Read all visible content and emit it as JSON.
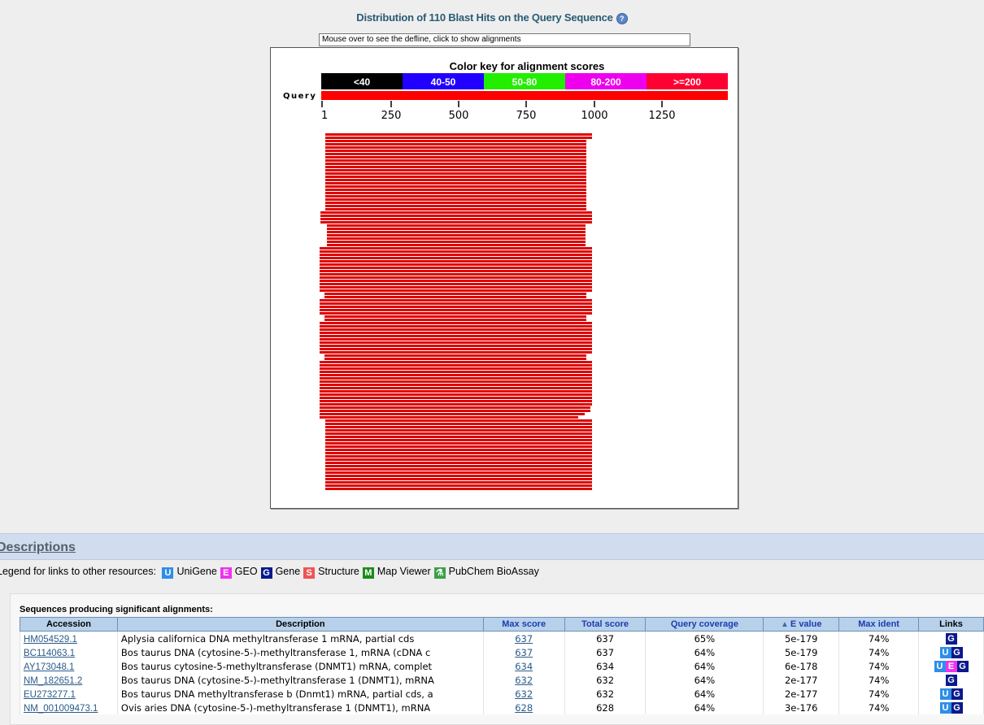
{
  "title": "Distribution of 110 Blast Hits on the Query Sequence",
  "help_icon": "?",
  "defline_text": "Mouse over to see the defline, click to show alignments",
  "graph": {
    "color_key_title": "Color key for alignment scores",
    "color_key": [
      {
        "label": "<40",
        "color": "#000000"
      },
      {
        "label": "40-50",
        "color": "#2200ff"
      },
      {
        "label": "50-80",
        "color": "#22ee00"
      },
      {
        "label": "80-200",
        "color": "#ee00ee"
      },
      {
        "label": ">=200",
        "color": "#ff0033"
      }
    ],
    "query_label": "Query",
    "ticks": [
      "1",
      "250",
      "500",
      "750",
      "1000",
      "1250"
    ],
    "hit_color": "#dd0000",
    "query_color": "#ff0000"
  },
  "descriptions_title": "Descriptions",
  "legend": {
    "prefix": "Legend for links to other resources:",
    "items": [
      {
        "letter": "U",
        "label": "UniGene",
        "color": "#2e8ee8",
        "icon": "unigene-icon"
      },
      {
        "letter": "E",
        "label": "GEO",
        "color": "#ee33ee",
        "icon": "geo-icon"
      },
      {
        "letter": "G",
        "label": "Gene",
        "color": "#0a1a8c",
        "icon": "gene-icon"
      },
      {
        "letter": "S",
        "label": "Structure",
        "color": "#ee5555",
        "icon": "structure-icon"
      },
      {
        "letter": "M",
        "label": "Map Viewer",
        "color": "#1a8a1a",
        "icon": "map-viewer-icon"
      },
      {
        "letter": "⚗",
        "label": "PubChem BioAssay",
        "color": "#3aa048",
        "icon": "pubchem-bioassay-icon"
      }
    ]
  },
  "table": {
    "caption": "Sequences producing significant alignments:",
    "headers": {
      "accession": "Accession",
      "description": "Description",
      "max_score": "Max score",
      "total_score": "Total score",
      "query_coverage": "Query coverage",
      "e_value": "E value",
      "max_ident": "Max ident",
      "links": "Links"
    },
    "rows": [
      {
        "accession": "HM054529.1",
        "description": "Aplysia californica DNA methyltransferase 1 mRNA, partial cds",
        "max_score": "637",
        "total_score": "637",
        "query_coverage": "65%",
        "e_value": "5e-179",
        "max_ident": "74%",
        "links": [
          "G"
        ]
      },
      {
        "accession": "BC114063.1",
        "description": "Bos taurus DNA (cytosine-5-)-methyltransferase 1, mRNA (cDNA c",
        "max_score": "637",
        "total_score": "637",
        "query_coverage": "64%",
        "e_value": "5e-179",
        "max_ident": "74%",
        "links": [
          "U",
          "G"
        ]
      },
      {
        "accession": "AY173048.1",
        "description": "Bos taurus cytosine-5-methyltransferase (DNMT1) mRNA, complet",
        "max_score": "634",
        "total_score": "634",
        "query_coverage": "64%",
        "e_value": "6e-178",
        "max_ident": "74%",
        "links": [
          "U",
          "E",
          "G"
        ]
      },
      {
        "accession": "NM_182651.2",
        "description": "Bos taurus DNA (cytosine-5-)-methyltransferase 1 (DNMT1), mRNA",
        "max_score": "632",
        "total_score": "632",
        "query_coverage": "64%",
        "e_value": "2e-177",
        "max_ident": "74%",
        "links": [
          "G"
        ]
      },
      {
        "accession": "EU273277.1",
        "description": "Bos taurus DNA methyltransferase b (Dnmt1) mRNA, partial cds, a",
        "max_score": "632",
        "total_score": "632",
        "query_coverage": "64%",
        "e_value": "2e-177",
        "max_ident": "74%",
        "links": [
          "U",
          "G"
        ]
      },
      {
        "accession": "NM_001009473.1",
        "description": "Ovis aries DNA (cytosine-5-)-methyltransferase 1 (DNMT1), mRNA",
        "max_score": "628",
        "total_score": "628",
        "query_coverage": "64%",
        "e_value": "3e-176",
        "max_ident": "74%",
        "links": [
          "U",
          "G"
        ]
      }
    ]
  }
}
